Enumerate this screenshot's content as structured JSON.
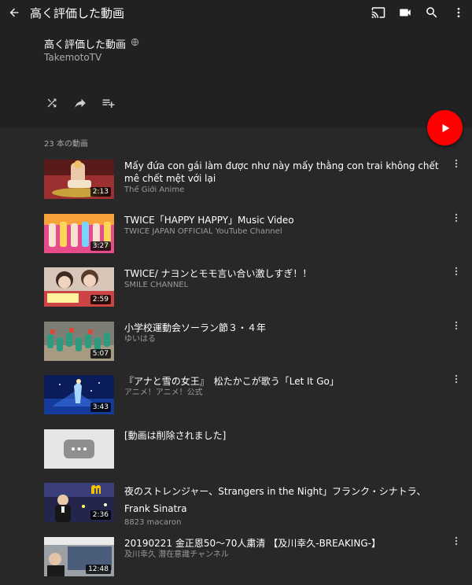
{
  "appbar": {
    "title": "高く評価した動画",
    "icons": [
      "back-arrow-icon",
      "cast-icon",
      "camera-icon",
      "search-icon",
      "more-vert-icon"
    ]
  },
  "playlist": {
    "title": "高く評価した動画",
    "owner": "TakemotoTV",
    "visibility_icon": "globe-icon",
    "tools": [
      "shuffle-icon",
      "share-icon",
      "add-to-playlist-icon"
    ]
  },
  "video_count": "23 本の動画",
  "colors": {
    "accent": "#ff0000",
    "background": "#282828",
    "header": "#212121"
  },
  "videos": [
    {
      "title": "Mấy đứa con gái làm được như này mấy thằng con trai không chết mê chết mệt với lại",
      "channel": "Thế Giới Anime",
      "duration": "2:13"
    },
    {
      "title": "TWICE「HAPPY HAPPY」Music Video",
      "channel": "TWICE JAPAN OFFICIAL YouTube Channel",
      "duration": "3:27"
    },
    {
      "title": "TWICE/ ナヨンとモモ言い合い激しすぎ！！",
      "channel": "SMILE CHANNEL",
      "duration": "2:59"
    },
    {
      "title": "小学校運動会ソーラン節３・４年",
      "channel": "ゆいはる",
      "duration": "5:07"
    },
    {
      "title": "『アナと雪の女王』　松たかこが歌う「Let It  Go」",
      "channel": "アニメ！アニメ！公式",
      "duration": "3:43"
    },
    {
      "title": "[動画は削除されました]",
      "channel": "",
      "duration": ""
    },
    {
      "title": "夜のストレンジャー、Strangers in the Night」フランク・シナトラ、Frank Sinatra",
      "channel": "8823 macaron",
      "duration": "2:36"
    },
    {
      "title": "20190221 金正恩50〜70人粛清 【及川幸久-BREAKING-】",
      "channel": "及川幸久 潜在意識チャンネル",
      "duration": "12:48"
    }
  ]
}
